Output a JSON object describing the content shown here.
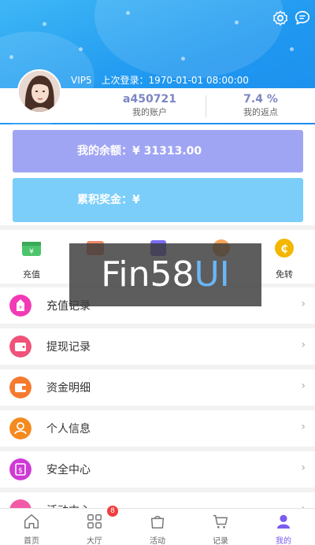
{
  "header": {
    "vip_level": "VIP5",
    "last_login": "上次登录：1970-01-01 08:00:00"
  },
  "stats": {
    "account_value": "a450721",
    "account_label": "我的账户",
    "rebate_value": "7.4 %",
    "rebate_label": "我的返点"
  },
  "balance": {
    "label": "我的余额：¥ 31313.00"
  },
  "bonus": {
    "label": "累积奖金：¥"
  },
  "actions": [
    {
      "label": "充值",
      "icon": "recharge-icon",
      "color": "#4cc46b"
    },
    {
      "label": "",
      "icon": "withdraw-icon",
      "color": "#f08a6a"
    },
    {
      "label": "",
      "icon": "transfer-icon",
      "color": "#7b6cf0"
    },
    {
      "label": "",
      "icon": "center-icon",
      "color": "#f5a45a"
    },
    {
      "label": "免转",
      "icon": "free-transfer-icon",
      "color": "#f3b700"
    }
  ],
  "watermark": {
    "main": "Fin58",
    "accent": "UI"
  },
  "menu": [
    {
      "label": "充值记录",
      "icon": "recharge-record-icon",
      "color": "#f33ab6"
    },
    {
      "label": "提现记录",
      "icon": "withdraw-record-icon",
      "color": "#f0527a"
    },
    {
      "label": "资金明细",
      "icon": "fund-detail-icon",
      "color": "#f57a2e"
    },
    {
      "label": "个人信息",
      "icon": "personal-info-icon",
      "color": "#f58a1f"
    },
    {
      "label": "安全中心",
      "icon": "security-icon",
      "color": "#cf3ad6"
    },
    {
      "label": "活动中心",
      "icon": "activity-icon",
      "color": "#f35aa6"
    }
  ],
  "menu_arrow": "›",
  "tabs": [
    {
      "label": "首页",
      "icon": "home-icon"
    },
    {
      "label": "大厅",
      "icon": "hall-icon"
    },
    {
      "label": "活动",
      "icon": "activity-bag-icon"
    },
    {
      "label": "记录",
      "icon": "cart-icon"
    },
    {
      "label": "我的",
      "icon": "user-icon"
    }
  ],
  "hall_badge": "8"
}
